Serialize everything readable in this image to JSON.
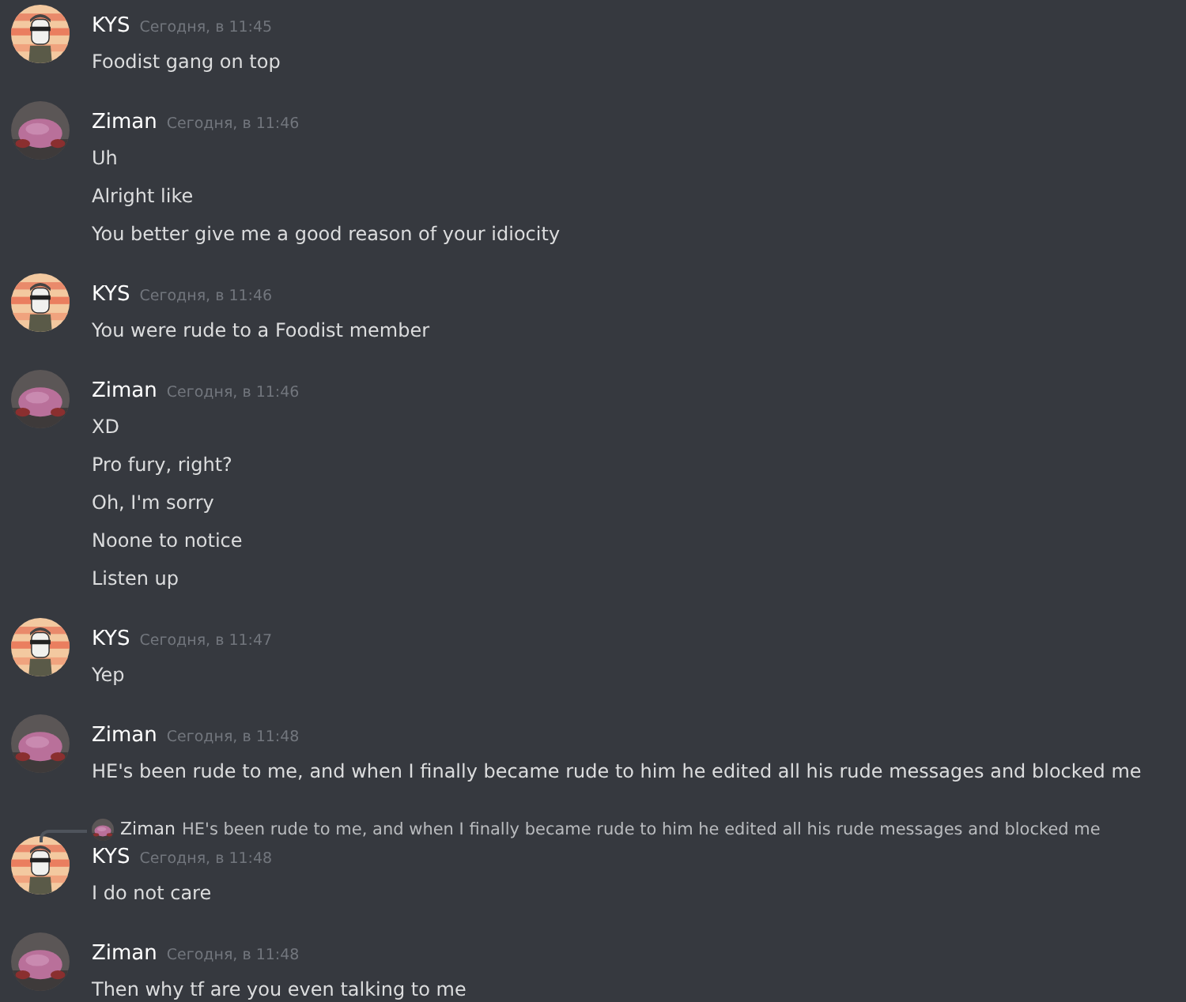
{
  "messages": [
    {
      "author": "KYS",
      "timestamp": "Сегодня, в 11:45",
      "lines": [
        "Foodist gang on top"
      ]
    },
    {
      "author": "Ziman",
      "timestamp": "Сегодня, в 11:46",
      "lines": [
        "Uh",
        "Alright like",
        "You better give me a good reason of your idiocity"
      ]
    },
    {
      "author": "KYS",
      "timestamp": "Сегодня, в 11:46",
      "lines": [
        "You were rude to a Foodist member"
      ]
    },
    {
      "author": "Ziman",
      "timestamp": "Сегодня, в 11:46",
      "lines": [
        "XD",
        "Pro fury, right?",
        "Oh, I'm sorry",
        "Noone to notice",
        "Listen up"
      ]
    },
    {
      "author": "KYS",
      "timestamp": "Сегодня, в 11:47",
      "lines": [
        "Yep"
      ]
    },
    {
      "author": "Ziman",
      "timestamp": "Сегодня, в 11:48",
      "lines": [
        "HE's been rude to me, and when I finally became rude to him he edited all his rude messages and blocked me"
      ]
    },
    {
      "author": "KYS",
      "timestamp": "Сегодня, в 11:48",
      "reply_to": {
        "author": "Ziman",
        "text": "HE's been rude to me, and when I finally became rude to him he edited all his rude messages and blocked me"
      },
      "lines": [
        "I do not care"
      ]
    },
    {
      "author": "Ziman",
      "timestamp": "Сегодня, в 11:48",
      "lines": [
        "Then why tf are you even talking to me"
      ]
    }
  ]
}
